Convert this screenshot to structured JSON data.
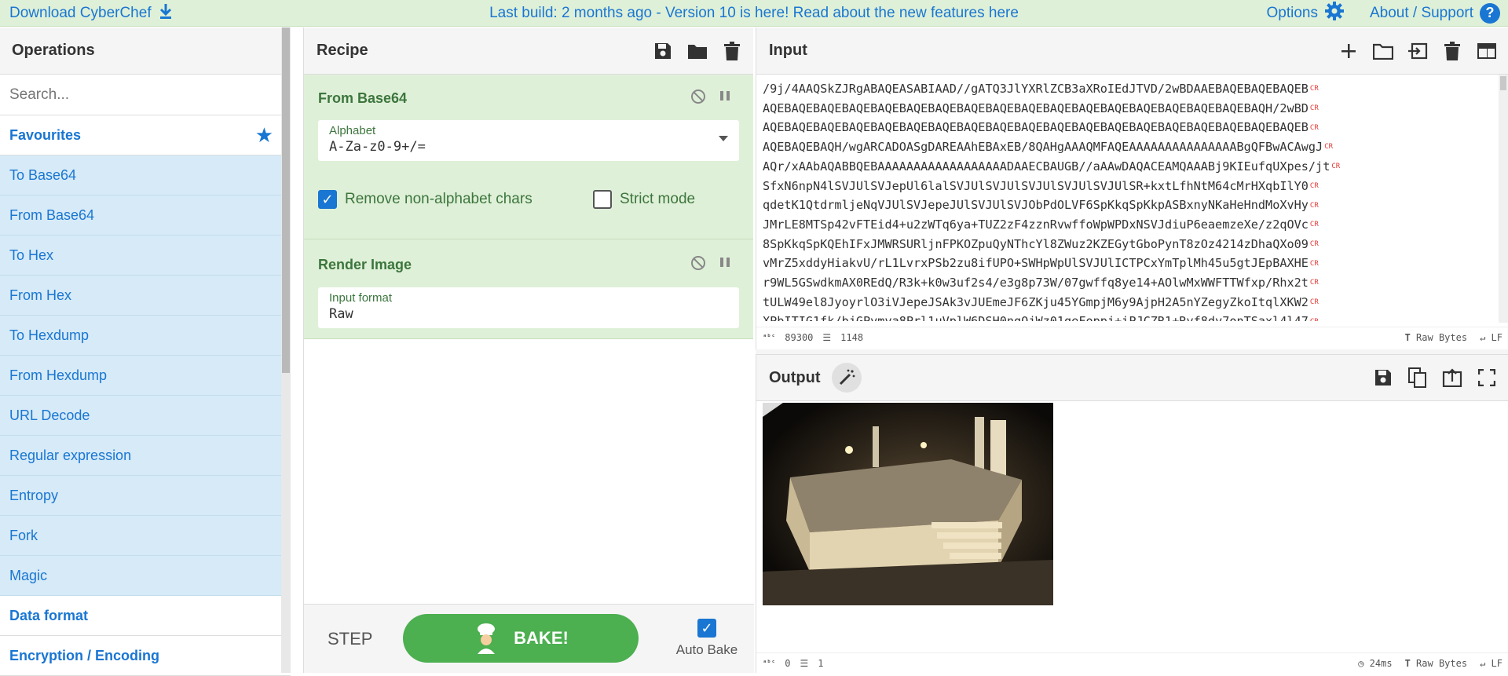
{
  "banner": {
    "download_label": "Download CyberChef",
    "center_text": "Last build: 2 months ago - Version 10 is here! Read about the new features here",
    "options_label": "Options",
    "about_label": "About / Support",
    "help_glyph": "?"
  },
  "operations": {
    "title": "Operations",
    "search_placeholder": "Search...",
    "favourites_label": "Favourites",
    "items": [
      "To Base64",
      "From Base64",
      "To Hex",
      "From Hex",
      "To Hexdump",
      "From Hexdump",
      "URL Decode",
      "Regular expression",
      "Entropy",
      "Fork",
      "Magic"
    ],
    "categories": [
      "Data format",
      "Encryption / Encoding"
    ]
  },
  "recipe": {
    "title": "Recipe",
    "ingredients": [
      {
        "name": "From Base64",
        "alphabet_label": "Alphabet",
        "alphabet_value": "A-Za-z0-9+/=",
        "remove_label": "Remove non-alphabet chars",
        "remove_checked": true,
        "strict_label": "Strict mode",
        "strict_checked": false
      },
      {
        "name": "Render Image",
        "format_label": "Input format",
        "format_value": "Raw"
      }
    ],
    "step_label": "STEP",
    "bake_label": "BAKE!",
    "autobake_label": "Auto Bake",
    "autobake_checked": true
  },
  "input": {
    "title": "Input",
    "lines": [
      "/9j/4AAQSkZJRgABAQEASABIAAD//gATQ3JlYXRlZCB3aXRoIEdJTVD/2wBDAAEBAQEBAQEBAQEB",
      "AQEBAQEBAQEBAQEBAQEBAQEBAQEBAQEBAQEBAQEBAQEBAQEBAQEBAQEBAQEBAQEBAQEBAQH/2wBD",
      "AQEBAQEBAQEBAQEBAQEBAQEBAQEBAQEBAQEBAQEBAQEBAQEBAQEBAQEBAQEBAQEBAQEBAQEBAQEB",
      "AQEBAQEBAQH/wgARCADOASgDAREAAhEBAxEB/8QAHgAAAQMFAQEAAAAAAAAAAAAAAABgQFBwACAwgJ",
      "AQr/xAAbAQABBQEBAAAAAAAAAAAAAAAAAADAAECBAUGB//aAAwDAQACEAMQAAABj9KIEufqUXpes/jt",
      "SfxN6npN4lSVJUlSVJepUl6lalSVJUlSVJUlSVJUlSVJUlSVJUlSR+kxtLfhNtM64cMrHXqbIlY0",
      "qdetK1QtdrmljeNqVJUlSVJepeJUlSVJUlSVJObPdOLVF6SpKkqSpKkpASBxnyNKaHeHndMoXvHy",
      "JMrLE8MTSp42vFTEid4+u2zWTq6ya+TUZ2zF4zznRvwffoWpWPDxNSVJdiuP6eaemzeXe/z2qOVc",
      "8SpKkqSpKQEhIFxJMWRSURljnFPKOZpuQyNThcYl8ZWuz2KZEGytGboPynT8zOz4214zDhaQXo09",
      "vMrZ5xddyHiakvU/rL1LvrxPSb2zu8ifUPO+SWHpWpUlSVJUlICTPCxYmTplMh45u5gtJEpBAXHE",
      "r9WL5GSwdkmAX0REdQ/R3k+k0w3uf2s4/e3g8p73W/07gwffq8ye14+AOlwMxWWFTTWfxp/Rhx2t",
      "tULW49el8JyoyrlO3iVJepeJSAk3vJUEmeJF6ZKju45YGmpjM6y9AjpH2A5nYZegyZkoItqlXKW2",
      "XPbITIG1fk/bjGPvmva8Prl1uVplW6DSH0ngQjWz01geFoppj+iPJCZR1+Rvf8dy7onTSaxl4l47"
    ],
    "char_count": "89300",
    "line_count": "1148",
    "encoding": "Raw Bytes",
    "eol": "LF"
  },
  "output": {
    "title": "Output",
    "char_count": "0",
    "line_count": "1",
    "time": "24ms",
    "encoding": "Raw Bytes",
    "eol": "LF"
  }
}
